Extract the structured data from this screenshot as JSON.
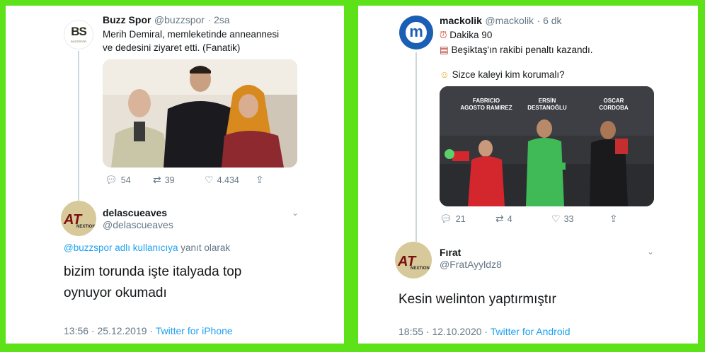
{
  "left": {
    "tweet": {
      "author": "Buzz Spor",
      "handle": "@buzzspor",
      "time": "· 2sa",
      "logo_text": "BS",
      "logo_sub": "BUZZSPOR",
      "line1": "Merih Demiral, memleketinde anneannesi",
      "line2": "ve dedesini ziyaret etti. (Fanatik)",
      "replies": "54",
      "retweets": "39",
      "likes": "4.434"
    },
    "reply": {
      "author": "delascueaves",
      "handle": "@delascueaves",
      "avatar_text": "AT",
      "avatar_sub": "NEXTION",
      "reply_to_user": "@buzzspor adlı kullanıcıya",
      "reply_to_suffix": " yanıt olarak",
      "line1": "bizim torunda işte italyada top",
      "line2": "oynuyor okumadı",
      "timestamp": "13:56 · 25.12.2019 · ",
      "source": "Twitter for iPhone"
    }
  },
  "right": {
    "tweet": {
      "author": "mackolik",
      "handle": "@mackolik",
      "time": "· 6 dk",
      "logo_letter": "m",
      "line1": "Dakika 90",
      "line2": "Beşiktaş'ın rakibi penaltı kazandı.",
      "line3": "Sizce kaleyi kim korumalı?",
      "player1_first": "FABRICIO",
      "player1_last": "AGOSTO RAMIREZ",
      "player2_first": "ERSİN",
      "player2_last": "DESTANOĞLU",
      "player3_first": "OSCAR",
      "player3_last": "CORDOBA",
      "replies": "21",
      "retweets": "4",
      "likes": "33"
    },
    "reply": {
      "author": "Fırat",
      "handle": "@FratAyyldz8",
      "avatar_text": "AT",
      "avatar_sub": "NEXTION",
      "line1": "Kesin welinton yaptırmıştır",
      "timestamp": "18:55 · 12.10.2020 · ",
      "source": "Twitter for Android"
    }
  },
  "colors": {
    "frame_green": "#5de21a",
    "link_blue": "#1da1f2",
    "muted": "#657786",
    "mackolik_blue": "#1b5fb4"
  }
}
